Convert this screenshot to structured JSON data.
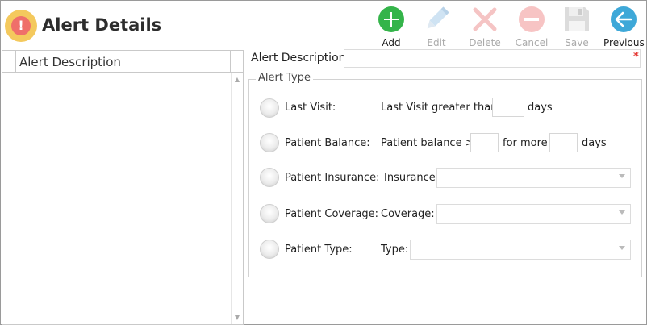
{
  "header": {
    "title": "Alert Details",
    "app_icon_glyph": "!"
  },
  "toolbar": {
    "add": "Add",
    "edit": "Edit",
    "delete": "Delete",
    "cancel": "Cancel",
    "save": "Save",
    "previous": "Previous"
  },
  "grid": {
    "column_header": "Alert Description"
  },
  "form": {
    "description_label": "Alert Description:",
    "required_mark": "*",
    "group_title": "Alert Type",
    "last_visit": {
      "label": "Last Visit:",
      "text": "Last Visit greater than",
      "unit": "days"
    },
    "patient_balance": {
      "label": "Patient Balance:",
      "text": "Patient balance >",
      "mid": "for more",
      "unit": "days"
    },
    "patient_insurance": {
      "label": "Patient Insurance:",
      "field": "Insurance:"
    },
    "patient_coverage": {
      "label": "Patient Coverage:",
      "field": "Coverage:"
    },
    "patient_type": {
      "label": "Patient Type:",
      "field": "Type:"
    }
  },
  "colors": {
    "add": "#34b44a",
    "previous": "#3ea8d8",
    "disabled": "#d4d4d4",
    "required": "#e53935",
    "icon_outer": "#f4c95d",
    "icon_inner": "#ef6f6a"
  }
}
